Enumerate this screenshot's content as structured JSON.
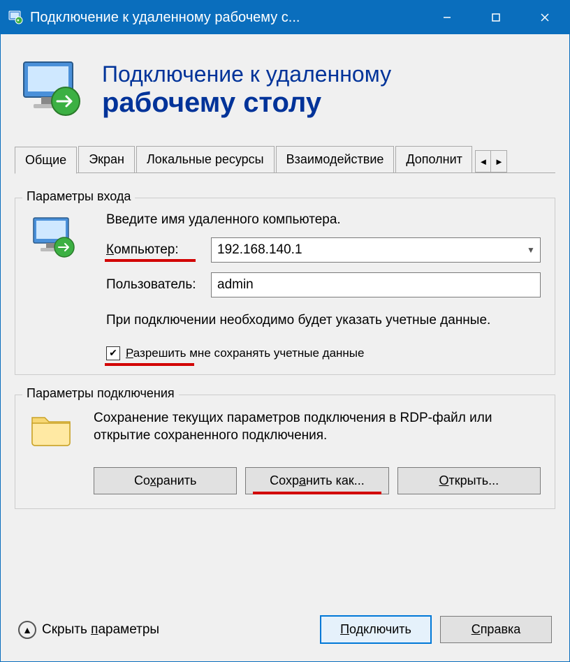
{
  "titlebar": {
    "text": "Подключение к удаленному рабочему с..."
  },
  "header": {
    "line1": "Подключение к удаленному",
    "line2": "рабочему столу"
  },
  "tabs": {
    "items": [
      "Общие",
      "Экран",
      "Локальные ресурсы",
      "Взаимодействие",
      "Дополнит"
    ],
    "active_index": 0
  },
  "login_group": {
    "title": "Параметры входа",
    "instruction": "Введите имя удаленного компьютера.",
    "computer_label": "Компьютер:",
    "computer_value": "192.168.140.1",
    "user_label": "Пользователь:",
    "user_value": "admin",
    "note": "При подключении необходимо будет указать учетные данные.",
    "allow_save_label": "Разрешить мне сохранять учетные данные",
    "allow_save_checked": true
  },
  "conn_group": {
    "title": "Параметры подключения",
    "text": "Сохранение текущих параметров подключения в RDP-файл или открытие сохраненного подключения.",
    "save_label": "Сохранить",
    "save_as_label": "Сохранить как...",
    "open_label": "Открыть..."
  },
  "footer": {
    "hide_label": "Скрыть параметры",
    "connect_label": "Подключить",
    "help_label": "Справка"
  }
}
